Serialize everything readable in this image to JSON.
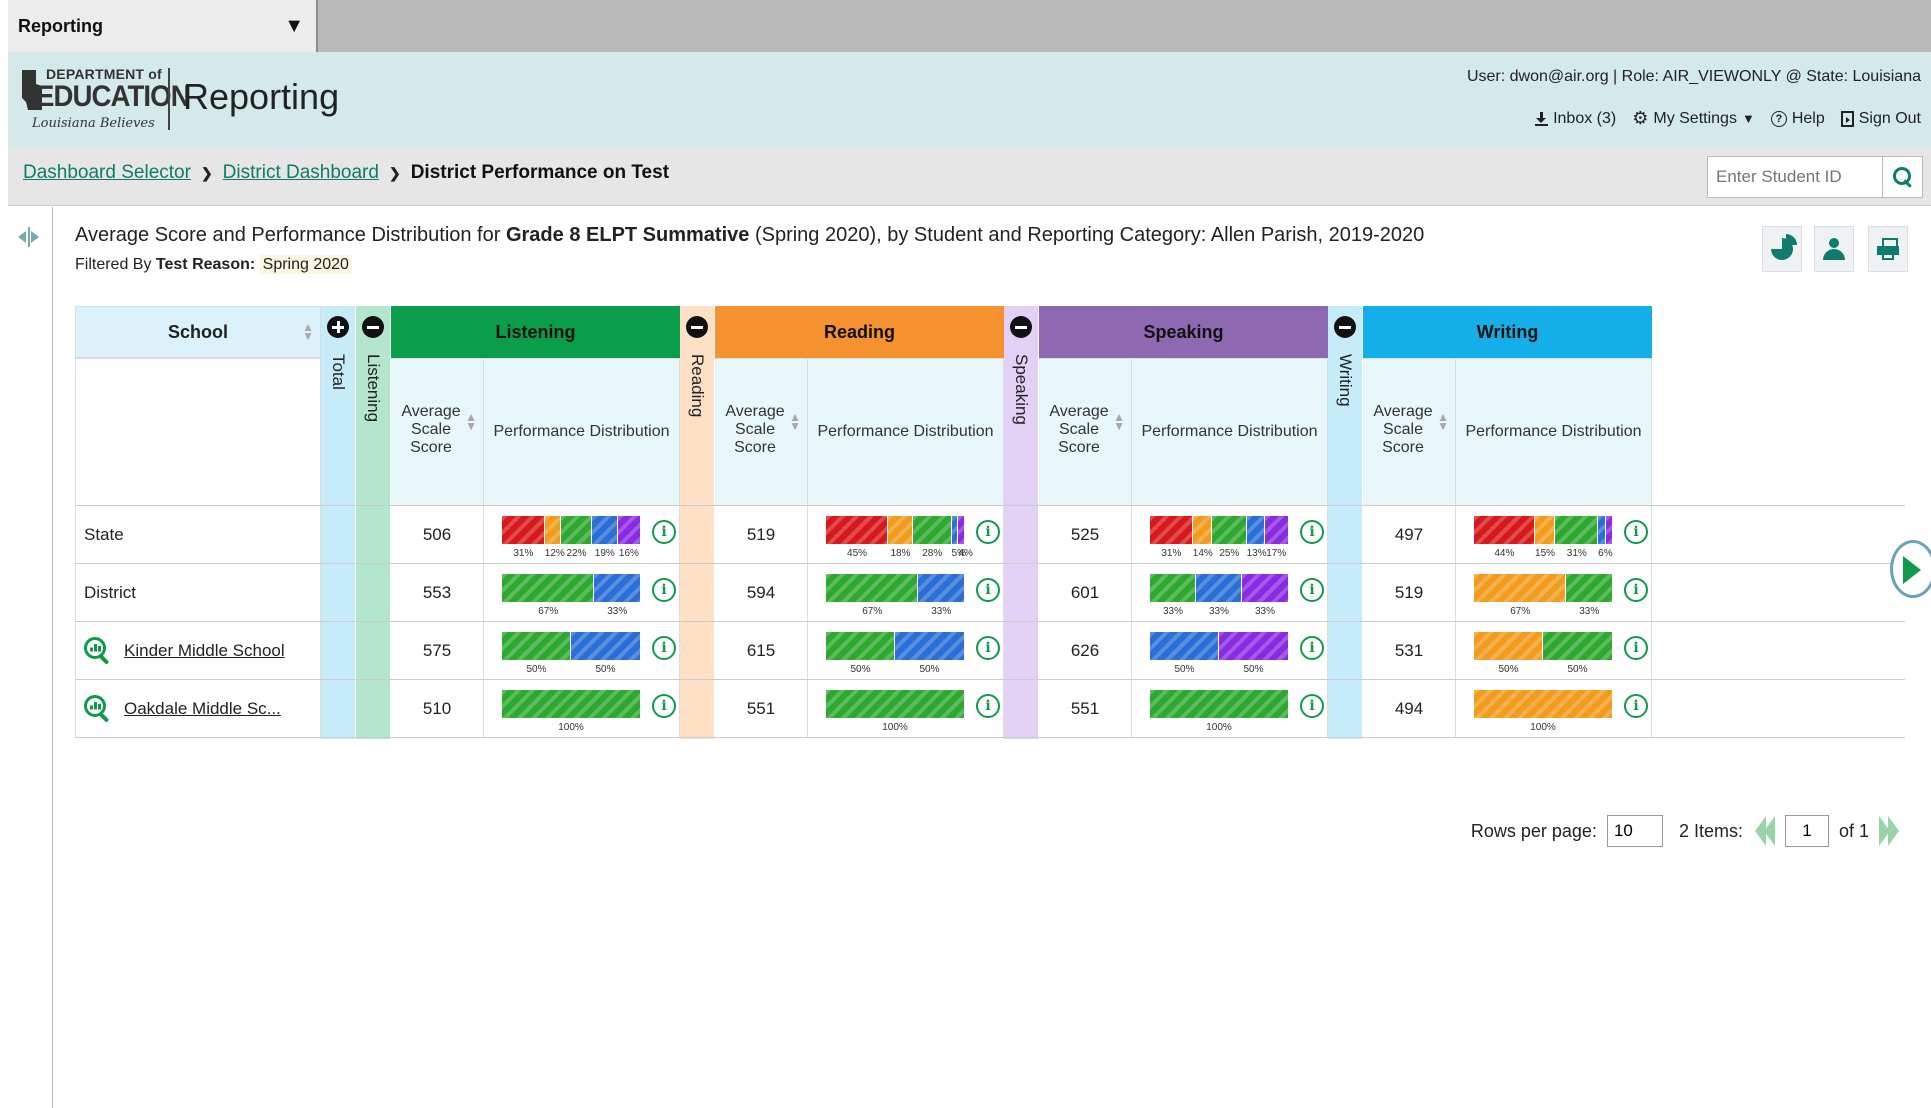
{
  "app_selector": {
    "label": "Reporting"
  },
  "header": {
    "logo": {
      "line1": "DEPARTMENT of",
      "line2": "EDUCATION",
      "tagline": "Louisiana Believes"
    },
    "title": "Reporting",
    "user_info": "User: dwon@air.org  |  Role: AIR_VIEWONLY @ State: Louisiana",
    "links": {
      "inbox": "Inbox (3)",
      "settings": "My Settings",
      "help": "Help",
      "signout": "Sign Out"
    }
  },
  "breadcrumb": {
    "items": [
      "Dashboard Selector",
      "District Dashboard"
    ],
    "current": "District Performance on Test"
  },
  "search": {
    "placeholder": "Enter Student ID"
  },
  "report": {
    "title_pre": "Average Score and Performance Distribution for ",
    "title_bold": "Grade 8 ELPT Summative",
    "title_post": " (Spring 2020), by Student and Reporting Category: Allen Parish, 2019-2020",
    "filter_pre": "Filtered By ",
    "filter_key": "Test Reason:",
    "filter_value": "Spring 2020"
  },
  "table": {
    "school_header": "School",
    "total_label": "Total",
    "avg_header": "Average Scale Score",
    "dist_header": "Performance Distribution",
    "categories": [
      {
        "name": "Listening",
        "color": "#0a9e4a",
        "pale": "#b3e6cc"
      },
      {
        "name": "Reading",
        "color": "#f5922f",
        "pale": "#fde0c6"
      },
      {
        "name": "Speaking",
        "color": "#8e68b1",
        "pale": "#e3d0f5"
      },
      {
        "name": "Writing",
        "color": "#14aee8",
        "pale": "#c6ecfa"
      }
    ],
    "level_colors": [
      "#d7191c",
      "#f29b1d",
      "#2ea82e",
      "#2a6fd6",
      "#8a2be2"
    ],
    "rows": [
      {
        "label": "State",
        "link": false,
        "cells": [
          {
            "score": "506",
            "dist": [
              31,
              12,
              22,
              19,
              16
            ],
            "labels": [
              "31%",
              "12%",
              "22%",
              "19%",
              "16%"
            ]
          },
          {
            "score": "519",
            "dist": [
              45,
              18,
              28,
              5,
              4
            ],
            "labels": [
              "45%",
              "18%",
              "28%",
              "5%",
              "4%"
            ]
          },
          {
            "score": "525",
            "dist": [
              31,
              14,
              25,
              13,
              17
            ],
            "labels": [
              "31%",
              "14%",
              "25%",
              "13%",
              "17%"
            ]
          },
          {
            "score": "497",
            "dist": [
              44,
              15,
              31,
              6,
              4
            ],
            "labels": [
              "44%",
              "15%",
              "31%",
              "6%",
              ""
            ]
          }
        ]
      },
      {
        "label": "District",
        "link": false,
        "cells": [
          {
            "score": "553",
            "dist": [
              0,
              0,
              67,
              33,
              0
            ],
            "labels": [
              "",
              "",
              "67%",
              "33%",
              ""
            ]
          },
          {
            "score": "594",
            "dist": [
              0,
              0,
              67,
              33,
              0
            ],
            "labels": [
              "",
              "",
              "67%",
              "33%",
              ""
            ]
          },
          {
            "score": "601",
            "dist": [
              0,
              0,
              33,
              33,
              33
            ],
            "labels": [
              "",
              "",
              "33%",
              "33%",
              "33%"
            ]
          },
          {
            "score": "519",
            "dist": [
              0,
              67,
              33,
              0,
              0
            ],
            "labels": [
              "",
              "67%",
              "33%",
              "",
              ""
            ]
          }
        ]
      },
      {
        "label": "Kinder Middle School",
        "link": true,
        "cells": [
          {
            "score": "575",
            "dist": [
              0,
              0,
              50,
              50,
              0
            ],
            "labels": [
              "",
              "",
              "50%",
              "50%",
              ""
            ]
          },
          {
            "score": "615",
            "dist": [
              0,
              0,
              50,
              50,
              0
            ],
            "labels": [
              "",
              "",
              "50%",
              "50%",
              ""
            ]
          },
          {
            "score": "626",
            "dist": [
              0,
              0,
              0,
              50,
              50
            ],
            "labels": [
              "",
              "",
              "",
              "50%",
              "50%"
            ]
          },
          {
            "score": "531",
            "dist": [
              0,
              50,
              50,
              0,
              0
            ],
            "labels": [
              "",
              "50%",
              "50%",
              "",
              ""
            ]
          }
        ]
      },
      {
        "label": "Oakdale Middle Sc...",
        "link": true,
        "cells": [
          {
            "score": "510",
            "dist": [
              0,
              0,
              100,
              0,
              0
            ],
            "labels": [
              "",
              "",
              "100%",
              "",
              ""
            ]
          },
          {
            "score": "551",
            "dist": [
              0,
              0,
              100,
              0,
              0
            ],
            "labels": [
              "",
              "",
              "100%",
              "",
              ""
            ]
          },
          {
            "score": "551",
            "dist": [
              0,
              0,
              100,
              0,
              0
            ],
            "labels": [
              "",
              "",
              "100%",
              "",
              ""
            ]
          },
          {
            "score": "494",
            "dist": [
              0,
              100,
              0,
              0,
              0
            ],
            "labels": [
              "",
              "100%",
              "",
              "",
              ""
            ]
          }
        ]
      }
    ]
  },
  "pager": {
    "rows_label": "Rows per page:",
    "rows_value": "10",
    "items_label": "2 Items:",
    "page_value": "1",
    "of_label": "of 1"
  }
}
